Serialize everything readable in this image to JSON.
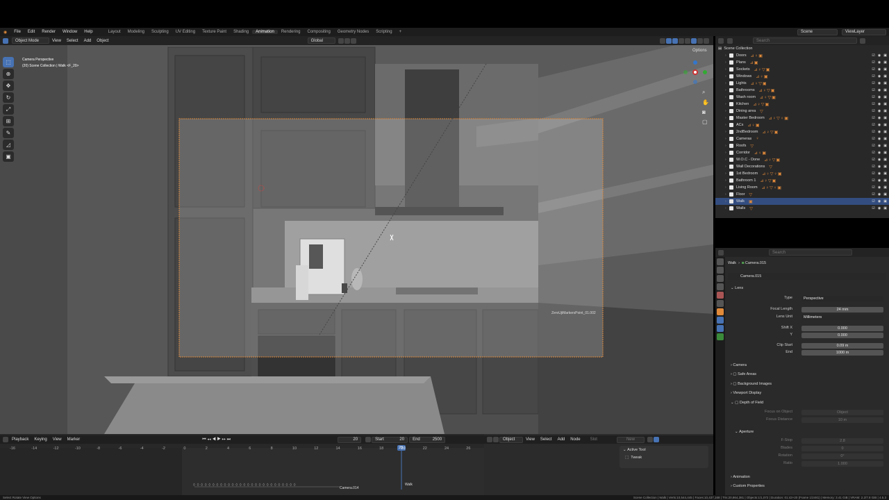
{
  "menus": [
    "File",
    "Edit",
    "Render",
    "Window",
    "Help"
  ],
  "workspaces": [
    "Layout",
    "Modeling",
    "Sculpting",
    "UV Editing",
    "Texture Paint",
    "Shading",
    "Animation",
    "Rendering",
    "Compositing",
    "Geometry Nodes",
    "Scripting"
  ],
  "active_workspace": "Animation",
  "scene": {
    "label": "Scene",
    "view_layer": "ViewLayer"
  },
  "viewport": {
    "mode": "Object Mode",
    "menu": [
      "View",
      "Select",
      "Add",
      "Object"
    ],
    "orientation": "Global",
    "options": "Options",
    "overlay_title": "Camera Perspective",
    "overlay_sub": "(20) Scene Collection | Walk <F_20>",
    "object_label": "ZeroUjiMarkersPoint_01.002"
  },
  "outliner": {
    "search_placeholder": "Search",
    "root": "Scene Collection",
    "items": [
      {
        "name": "Doors",
        "icons": "⊿♀▣"
      },
      {
        "name": "Plans",
        "icons": "⊿▣"
      },
      {
        "name": "Sockets",
        "icons": "⊿♀▽▣"
      },
      {
        "name": "Windows",
        "icons": "⊿♀▣"
      },
      {
        "name": "Lights",
        "icons": "⊿♀▽▣"
      },
      {
        "name": "Bathrooms",
        "icons": "⊿♀▽▣"
      },
      {
        "name": "Wash room",
        "icons": "⊿♀▽▣"
      },
      {
        "name": "Kitchen",
        "icons": "⊿♀▽▣"
      },
      {
        "name": "Dining area",
        "icons": "▽"
      },
      {
        "name": "Master Bedroom",
        "icons": "⊿♀▽♀▣"
      },
      {
        "name": "ACs",
        "icons": "⊿♀▣"
      },
      {
        "name": "2ndBedroom",
        "icons": "⊿♀▽▣"
      },
      {
        "name": "Cameras",
        "icons": "♀"
      },
      {
        "name": "Roofs",
        "icons": "▽"
      },
      {
        "name": "Corridor",
        "icons": "⊿♀▣"
      },
      {
        "name": "W.O.C - Done",
        "icons": "⊿♀▽▣"
      },
      {
        "name": "Wall Decorations",
        "icons": "▽"
      },
      {
        "name": "1st Bedroom",
        "icons": "⊿♀▽♀▣"
      },
      {
        "name": "Bathroom 1",
        "icons": "⊿♀▽▣"
      },
      {
        "name": "Living Room",
        "icons": "⊿♀▽♀▣"
      },
      {
        "name": "Floor",
        "icons": "▽"
      },
      {
        "name": "Walk",
        "icons": "▣"
      },
      {
        "name": "Walls",
        "icons": "▽"
      }
    ],
    "selected": "Walk"
  },
  "properties": {
    "search_placeholder": "Search",
    "breadcrumb": [
      "Walk",
      "Camera.015"
    ],
    "datablock": "Camera.015",
    "lens_section": "Lens",
    "type_label": "Type",
    "type_value": "Perspective",
    "focal_label": "Focal Length",
    "focal_value": "24 mm",
    "lens_unit_label": "Lens Unit",
    "lens_unit_value": "Millimeters",
    "shift_x_label": "Shift X",
    "shift_x_value": "0.000",
    "shift_y_label": "Y",
    "shift_y_value": "0.000",
    "clip_start_label": "Clip Start",
    "clip_start_value": "0.09 m",
    "clip_end_label": "End",
    "clip_end_value": "1000 m",
    "sections": [
      "Camera",
      "Safe Areas",
      "Background Images",
      "Viewport Display",
      "Depth of Field"
    ],
    "focus_object_label": "Focus on Object",
    "focus_object_placeholder": "Object",
    "focus_distance_label": "Focus Distance",
    "focus_distance_value": "10 m",
    "aperture_section": "Aperture",
    "fstop_label": "F-Stop",
    "fstop_value": "2.8",
    "blades_label": "Blades",
    "blades_value": "0",
    "rotation_label": "Rotation",
    "rotation_value": "0°",
    "ratio_label": "Ratio",
    "ratio_value": "1.000",
    "bottom_sections": [
      "Animation",
      "Custom Properties"
    ]
  },
  "timeline": {
    "menu": [
      "Playback",
      "Keying",
      "View",
      "Marker"
    ],
    "current_frame": "20",
    "start_label": "Start",
    "start_value": "20",
    "end_label": "End",
    "end_value": "2500",
    "ticks": [
      "-16",
      "-14",
      "-12",
      "-10",
      "-8",
      "-6",
      "-4",
      "-2",
      "0",
      "2",
      "4",
      "6",
      "8",
      "10",
      "12",
      "14",
      "16",
      "18",
      "20",
      "22",
      "24",
      "26"
    ],
    "marker_label": "Camera.014",
    "walk_label": "Walk"
  },
  "node_editor": {
    "mode": "Object",
    "menu": [
      "View",
      "Select",
      "Add",
      "Node"
    ],
    "slot": "Slot",
    "new": "New",
    "active_tool_title": "Active Tool",
    "tool_name": "Tweak"
  },
  "status": {
    "left": "Select    Rotate View    Options",
    "right": "Scene Collection | Walk | Verts:10,544,445 | Faces:10,437,168 | Tris:20,864,381 | Objects:1/1,072 | Duration: 01:43+20 (Frame 1/2481) | Memory: 3.41 GiB | VRAM: 2.2/7.8 GiB | 4.5.3"
  }
}
